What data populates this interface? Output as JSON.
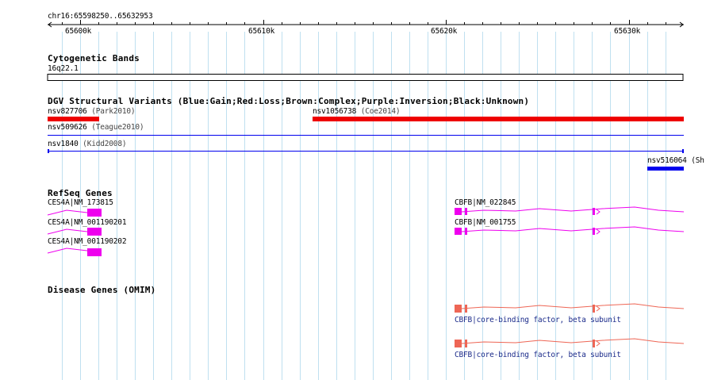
{
  "region": "chr16:65598250..65632953",
  "ruler": {
    "ticks": [
      "65600k",
      "65610k",
      "65620k",
      "65630k"
    ]
  },
  "colors": {
    "gridline": "#bfe0f0",
    "loss": "#ee0000",
    "gain": "#0000ee",
    "refseq": "#ee00ee",
    "omim": "#ee6655",
    "omim_label": "#1a2a8a"
  },
  "tracks": {
    "cytoband": {
      "title": "Cytogenetic Bands",
      "band": "16q22.1"
    },
    "dgv": {
      "title": "DGV Structural Variants (Blue:Gain;Red:Loss;Brown:Complex;Purple:Inversion;Black:Unknown)",
      "features": [
        {
          "id": "nsv827706",
          "source": "(Park2010)",
          "type": "Loss"
        },
        {
          "id": "nsv1056738",
          "source": "(Coe2014)",
          "type": "Loss"
        },
        {
          "id": "nsv509626",
          "source": "(Teague2010)",
          "type": "Gain"
        },
        {
          "id": "nsv1840",
          "source": "(Kidd2008)",
          "type": "Gain"
        },
        {
          "id": "nsv516064 (Sh",
          "source": "",
          "type": "Gain"
        }
      ]
    },
    "refseq": {
      "title": "RefSeq Genes",
      "genes": [
        "CES4A|NM_173815",
        "CES4A|NM_001190201",
        "CES4A|NM_001190202",
        "CBFB|NM_022845",
        "CBFB|NM_001755"
      ]
    },
    "omim": {
      "title": "Disease Genes (OMIM)",
      "genes": [
        "CBFB|core-binding factor, beta subunit",
        "CBFB|core-binding factor, beta subunit"
      ]
    }
  }
}
